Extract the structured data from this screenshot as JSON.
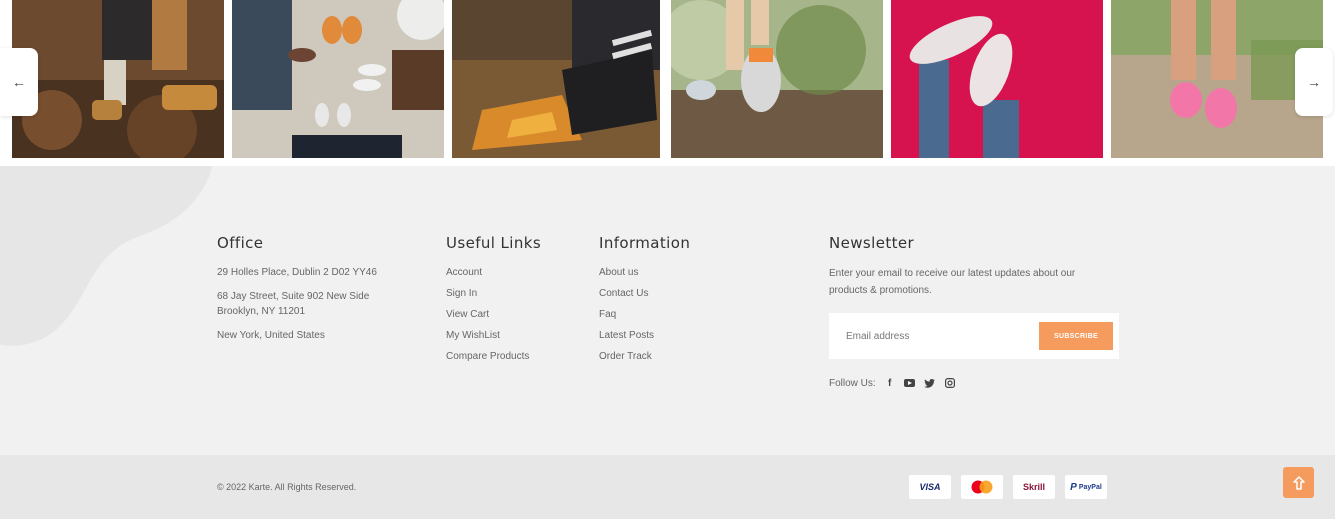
{
  "gallery": {
    "prev_icon": "arrow-left-icon",
    "next_icon": "arrow-right-icon",
    "prev_glyph": "←",
    "next_glyph": "→"
  },
  "office": {
    "title": "Office",
    "address1": "29 Holles Place, Dublin 2 D02 YY46",
    "address2_line1": "68 Jay Street, Suite 902 New Side",
    "address2_line2": "Brooklyn, NY 11201",
    "address3": "New York, United States"
  },
  "useful_links": {
    "title": "Useful Links",
    "items": [
      "Account",
      "Sign In",
      "View Cart",
      "My WishList",
      "Compare Products"
    ]
  },
  "information": {
    "title": "Information",
    "items": [
      "About us",
      "Contact Us",
      "Faq",
      "Latest Posts",
      "Order Track"
    ]
  },
  "newsletter": {
    "title": "Newsletter",
    "intro": "Enter your email to receive our latest updates about our products & promotions.",
    "email_placeholder": "Email address",
    "email_value": "",
    "subscribe_label": "SUBSCRIBE",
    "follow_label": "Follow Us:",
    "social": [
      "facebook-icon",
      "youtube-icon",
      "twitter-icon",
      "instagram-icon"
    ]
  },
  "bottom": {
    "copyright": "© 2022 Karte. All Rights Reserved.",
    "payments": [
      "VISA",
      "Mastercard",
      "Skrill",
      "PayPal"
    ],
    "visa_label": "VISA",
    "skrill_label": "Skrill",
    "paypal_label": "PayPal",
    "scroll_top_icon": "arrow-up-icon"
  },
  "colors": {
    "accent": "#f59b5e",
    "footer_bg": "#f1f1f1",
    "bottom_bg": "#e7e7e7"
  }
}
